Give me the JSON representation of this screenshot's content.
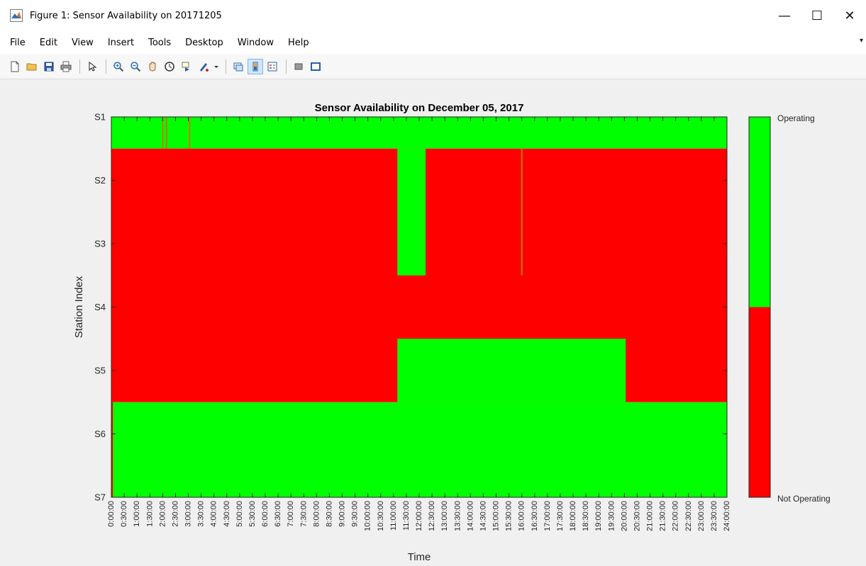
{
  "window": {
    "title": "Figure 1: Sensor Availability on 20171205",
    "controls": {
      "minimize": "—",
      "maximize": "☐",
      "close": "✕"
    }
  },
  "menubar": {
    "items": [
      "File",
      "Edit",
      "View",
      "Insert",
      "Tools",
      "Desktop",
      "Window",
      "Help"
    ]
  },
  "toolbar": {
    "buttons": [
      "new-figure",
      "open-file",
      "save",
      "print",
      "edit-plot",
      "zoom-in",
      "zoom-out",
      "pan",
      "rotate-3d",
      "data-cursor",
      "brush",
      "link-plot",
      "insert-colorbar",
      "insert-legend",
      "hide-plot-tools",
      "show-plot-tools"
    ]
  },
  "chart_data": {
    "type": "heatmap",
    "title": "Sensor Availability on December 05, 2017",
    "xlabel": "Time",
    "ylabel": "Station Index",
    "xlim": [
      0,
      24
    ],
    "y_categories": [
      "S1",
      "S2",
      "S3",
      "S4",
      "S5",
      "S6",
      "S7"
    ],
    "x_tick_labels": [
      "0:00:00",
      "0:30:00",
      "1:00:00",
      "1:30:00",
      "2:00:00",
      "2:30:00",
      "3:00:00",
      "3:30:00",
      "4:00:00",
      "4:30:00",
      "5:00:00",
      "5:30:00",
      "6:00:00",
      "6:30:00",
      "7:00:00",
      "7:30:00",
      "8:00:00",
      "8:30:00",
      "9:00:00",
      "9:30:00",
      "10:00:00",
      "10:30:00",
      "11:00:00",
      "11:30:00",
      "12:00:00",
      "12:30:00",
      "13:00:00",
      "13:30:00",
      "14:00:00",
      "14:30:00",
      "15:00:00",
      "15:30:00",
      "16:00:00",
      "16:30:00",
      "17:00:00",
      "17:30:00",
      "18:00:00",
      "18:30:00",
      "19:00:00",
      "19:30:00",
      "20:00:00",
      "20:30:00",
      "21:00:00",
      "21:30:00",
      "22:00:00",
      "22:30:00",
      "23:00:00",
      "23:30:00",
      "24:00:00"
    ],
    "colormap": [
      "#ff0000",
      "#00ff00"
    ],
    "colorbar_labels": {
      "top": "Operating",
      "bottom": "Not Operating"
    },
    "colors": {
      "operating": "#00ff00",
      "not_operating": "#ff0000",
      "outage_mark": "#c87800"
    },
    "background": [
      {
        "x": [
          0,
          24
        ],
        "y": [
          1,
          1.5
        ],
        "state": "operating"
      },
      {
        "x": [
          0,
          24
        ],
        "y": [
          1.5,
          5.5
        ],
        "state": "not_operating"
      },
      {
        "x": [
          0,
          24
        ],
        "y": [
          5.5,
          7
        ],
        "state": "operating"
      }
    ],
    "segments": [
      {
        "x": [
          11.15,
          12.25
        ],
        "y": [
          1.5,
          3.5
        ],
        "state": "operating"
      },
      {
        "x": [
          11.15,
          20.05
        ],
        "y": [
          4.5,
          5.5
        ],
        "state": "operating"
      },
      {
        "x": [
          0,
          0.06
        ],
        "y": [
          5.5,
          7
        ],
        "state": "not_operating"
      }
    ],
    "vertical_marks": [
      {
        "x": 2.0,
        "y": [
          1,
          1.5
        ]
      },
      {
        "x": 2.15,
        "y": [
          1,
          1.5
        ]
      },
      {
        "x": 3.05,
        "y": [
          1,
          1.5
        ]
      },
      {
        "x": 16.0,
        "y": [
          1.5,
          3.5
        ]
      }
    ]
  }
}
